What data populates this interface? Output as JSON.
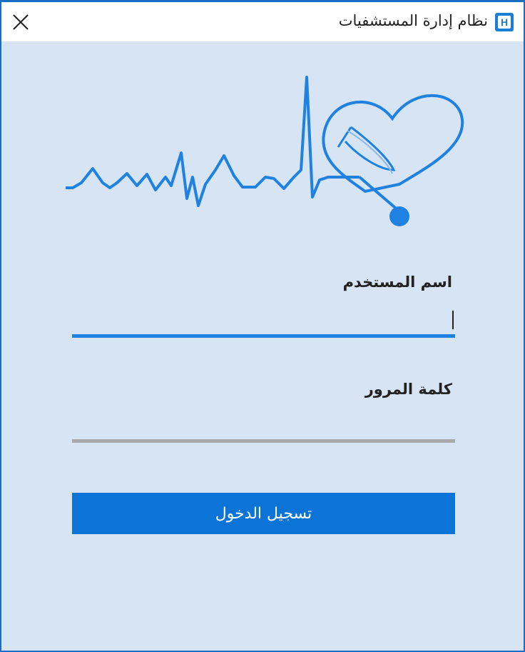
{
  "window": {
    "title": "نظام إدارة المستشفيات",
    "app_icon_letter": "H",
    "accent_color": "#0b74d6",
    "background_color": "#d6e4f3"
  },
  "login": {
    "username_label": "اسم المستخدم",
    "username_value": "",
    "password_label": "كلمة المرور",
    "password_value": "",
    "submit_label": "تسجيل الدخول"
  },
  "icons": {
    "close": "close-icon",
    "logo": "heartbeat-stethoscope-logo"
  }
}
